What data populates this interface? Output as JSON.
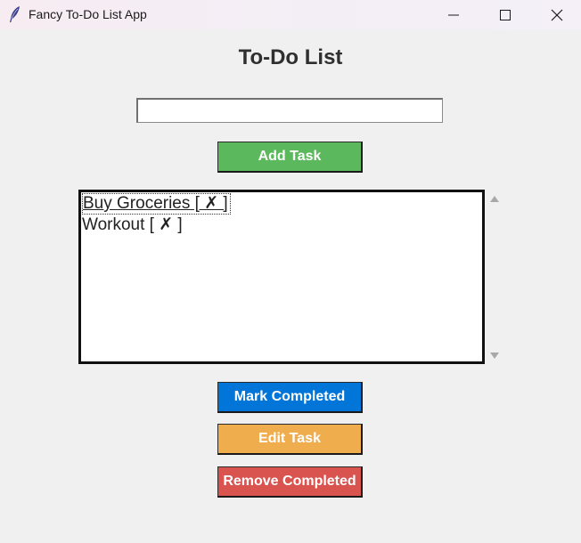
{
  "window": {
    "title": "Fancy To-Do List App",
    "icon": "feather-icon"
  },
  "app": {
    "heading": "To-Do List",
    "task_input": {
      "value": "",
      "placeholder": ""
    },
    "add_button": {
      "label": "Add Task",
      "color": "#5cb85c"
    },
    "tasks": [
      {
        "label": "Buy Groceries [ ✗ ]",
        "active": true
      },
      {
        "label": "Workout [ ✗ ]",
        "active": false
      }
    ],
    "mark_button": {
      "label": "Mark Completed",
      "color": "#0275d8"
    },
    "edit_button": {
      "label": "Edit Task",
      "color": "#f0ad4e"
    },
    "remove_button": {
      "label": "Remove Completed",
      "color": "#d9534f"
    }
  }
}
